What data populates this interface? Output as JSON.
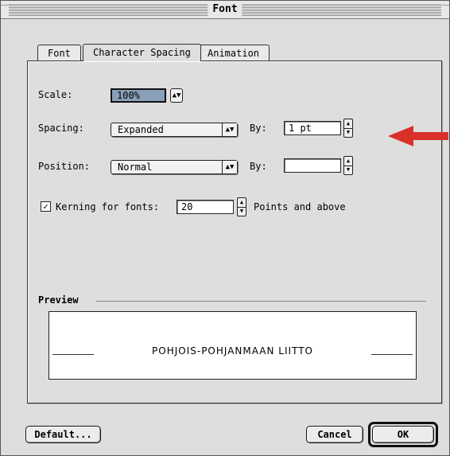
{
  "window": {
    "title": "Font"
  },
  "tabs": [
    {
      "label": "Font",
      "active": false
    },
    {
      "label": "Character Spacing",
      "active": true
    },
    {
      "label": "Animation",
      "active": false
    }
  ],
  "scale": {
    "label": "Scale:",
    "value": "100%"
  },
  "spacing": {
    "label": "Spacing:",
    "value": "Expanded",
    "by_label": "By:",
    "by_value": "1 pt"
  },
  "position": {
    "label": "Position:",
    "value": "Normal",
    "by_label": "By:",
    "by_value": ""
  },
  "kerning": {
    "checked": true,
    "label": "Kerning for fonts:",
    "value": "20",
    "suffix": "Points and above"
  },
  "preview": {
    "heading": "Preview",
    "sample_text": "POHJOIS-POHJANMAAN LIITTO"
  },
  "buttons": {
    "default": "Default...",
    "cancel": "Cancel",
    "ok": "OK"
  },
  "annotation": {
    "arrow_color": "#d9302a"
  },
  "icons": {
    "popup_arrows": "updown-arrows-icon",
    "stepper": "stepper-arrows-icon",
    "checkmark": "checkmark-icon"
  }
}
